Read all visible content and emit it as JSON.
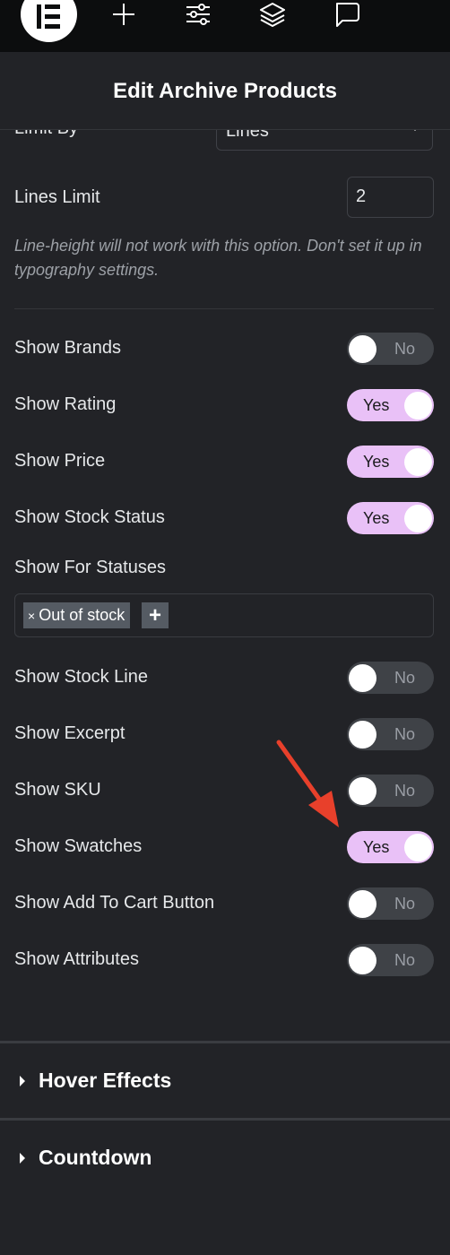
{
  "toolbar": {
    "icons": [
      "elementor-logo-icon",
      "add-icon",
      "settings-sliders-icon",
      "layers-icon",
      "comment-icon"
    ]
  },
  "header": {
    "title": "Edit Archive Products"
  },
  "limit_by": {
    "label": "Limit By",
    "value": "Lines"
  },
  "lines_limit": {
    "label": "Lines Limit",
    "value": "2"
  },
  "note": "Line-height will not work with this option. Don't set it up in typography settings.",
  "toggles": [
    {
      "label": "Show Brands",
      "state": "No",
      "on": false
    },
    {
      "label": "Show Rating",
      "state": "Yes",
      "on": true
    },
    {
      "label": "Show Price",
      "state": "Yes",
      "on": true
    },
    {
      "label": "Show Stock Status",
      "state": "Yes",
      "on": true
    }
  ],
  "statuses": {
    "label": "Show For Statuses",
    "tags": [
      {
        "remove": "×",
        "text": "Out of stock"
      }
    ],
    "add": "+"
  },
  "toggles2": [
    {
      "label": "Show Stock Line",
      "state": "No",
      "on": false
    },
    {
      "label": "Show Excerpt",
      "state": "No",
      "on": false
    },
    {
      "label": "Show SKU",
      "state": "No",
      "on": false
    },
    {
      "label": "Show Swatches",
      "state": "Yes",
      "on": true
    },
    {
      "label": "Show Add To Cart Button",
      "state": "No",
      "on": false
    },
    {
      "label": "Show Attributes",
      "state": "No",
      "on": false
    }
  ],
  "sections": [
    {
      "title": "Hover Effects"
    },
    {
      "title": "Countdown"
    }
  ],
  "colors": {
    "toggle_on": "#e9c1f7",
    "toggle_off": "#3f4247",
    "annotation_arrow": "#e8402b"
  }
}
